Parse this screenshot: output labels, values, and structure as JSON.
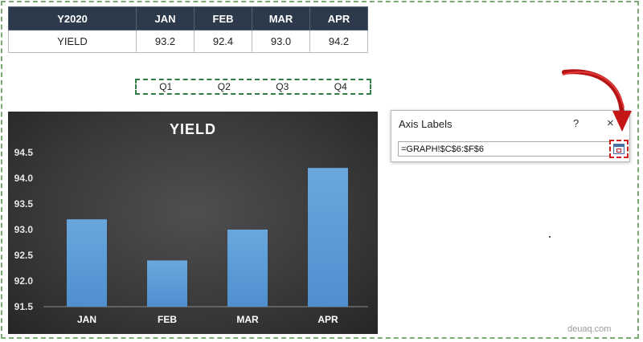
{
  "table": {
    "headers": [
      "Y2020",
      "JAN",
      "FEB",
      "MAR",
      "APR"
    ],
    "row_label": "YIELD",
    "values": [
      "93.2",
      "92.4",
      "93.0",
      "94.2"
    ]
  },
  "quarters": [
    "Q1",
    "Q2",
    "Q3",
    "Q4"
  ],
  "dialog": {
    "title": "Axis Labels",
    "help": "?",
    "close": "×",
    "range_value": "=GRAPH!$C$6:$F$6"
  },
  "watermark": "deuaq.com",
  "colors": {
    "header_bg": "#2d3a4c",
    "bar": "#5b9bd5",
    "highlight": "#d21d1d",
    "range_border": "#2f7d45"
  },
  "icons": [
    "close-icon",
    "collapse-dialog-icon",
    "red-arrow-icon"
  ],
  "chart_data": {
    "type": "bar",
    "title": "YIELD",
    "categories": [
      "JAN",
      "FEB",
      "MAR",
      "APR"
    ],
    "values": [
      93.2,
      92.4,
      93.0,
      94.2
    ],
    "ylim": [
      91.5,
      94.5
    ],
    "yticks": [
      "94.5",
      "94.0",
      "93.5",
      "93.0",
      "92.5",
      "92.0",
      "91.5"
    ],
    "xlabel": "",
    "ylabel": "",
    "grid": false,
    "legend": "none"
  }
}
